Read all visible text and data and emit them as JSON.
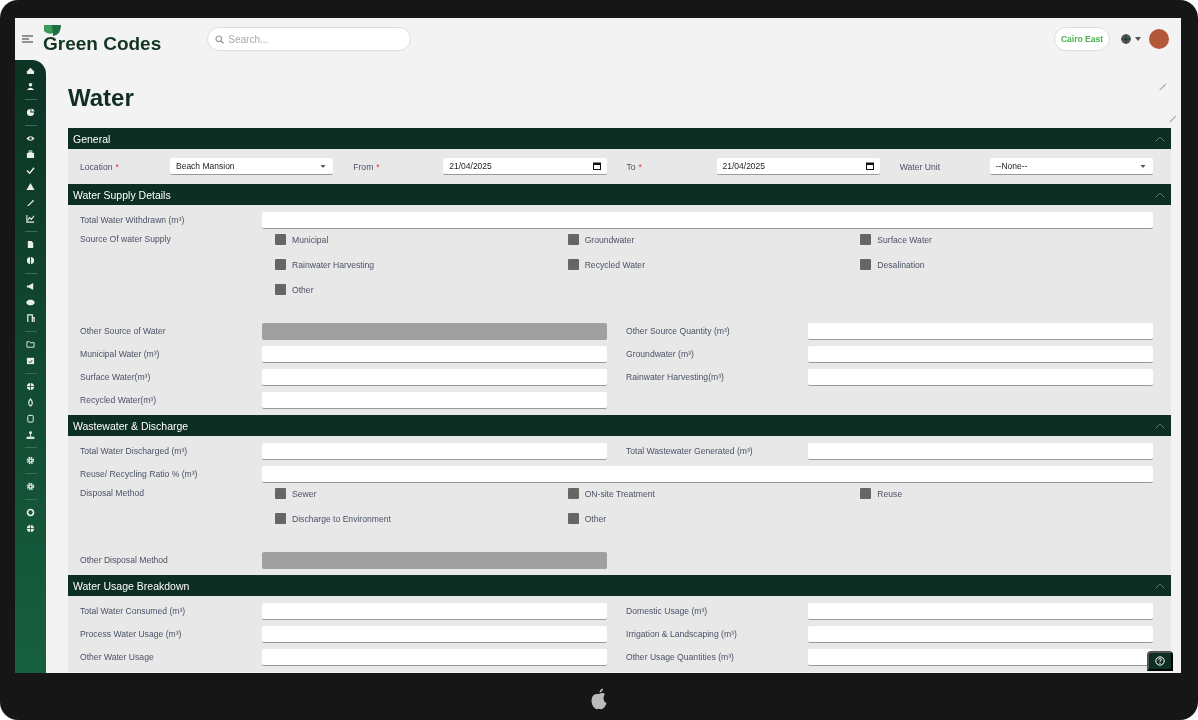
{
  "header": {
    "brand": "Green Codes",
    "search": {
      "placeholder": "Search..."
    },
    "location_chip": "Cairo East"
  },
  "page_title": "Water",
  "sections": [
    {
      "title": "General",
      "expanded": true,
      "rows": [
        {
          "kind": "inline",
          "items": [
            {
              "label": "Location",
              "required_mark": "*",
              "kind": "select",
              "value": "Beach Mansion"
            },
            {
              "label": "From",
              "required_mark": "*",
              "kind": "date",
              "value": "21/04/2025"
            },
            {
              "label": "To",
              "required_mark": "*",
              "kind": "date",
              "value": "21/04/2025"
            },
            {
              "label": "Water Unit",
              "kind": "select",
              "value": "--None--"
            }
          ]
        }
      ]
    },
    {
      "title": "Water Supply Details",
      "expanded": true,
      "rows": [
        {
          "kind": "full",
          "label": "Total Water Withdrawn (m³)"
        },
        {
          "kind": "checks",
          "label": "Source Of water Supply",
          "options": [
            {
              "label": "Municipal",
              "checked": false
            },
            {
              "label": "Groundwater",
              "checked": false
            },
            {
              "label": "Surface Water",
              "checked": false
            },
            {
              "label": "Rainwater Harvesting",
              "checked": false
            },
            {
              "label": "Recycled Water",
              "checked": false
            },
            {
              "label": "Desalination",
              "checked": false
            },
            {
              "label": "Other",
              "checked": false
            }
          ]
        },
        {
          "kind": "pair",
          "fields": [
            {
              "label": "Other Source of Water",
              "disabled": true
            },
            {
              "label": "Other Source Quantity (m³)",
              "disabled": false
            }
          ]
        },
        {
          "kind": "pair",
          "fields": [
            {
              "label": "Municipal Water (m³)",
              "disabled": false
            },
            {
              "label": "Groundwater (m³)",
              "disabled": false
            }
          ]
        },
        {
          "kind": "pair",
          "fields": [
            {
              "label": "Surface Water(m³)",
              "disabled": false
            },
            {
              "label": "Rainwater Harvesting(m³)",
              "disabled": false
            }
          ]
        },
        {
          "kind": "pair",
          "fields": [
            {
              "label": "Recycled Water(m³)",
              "disabled": false
            }
          ]
        }
      ]
    },
    {
      "title": "Wastewater & Discharge",
      "expanded": true,
      "rows": [
        {
          "kind": "pair",
          "fields": [
            {
              "label": "Total Water Discharged (m³)",
              "disabled": false
            },
            {
              "label": "Total Wastewater Generated (m³)",
              "disabled": false
            }
          ]
        },
        {
          "kind": "full",
          "label": "Reuse/ Recycling Ratio % (m³)"
        },
        {
          "kind": "checks",
          "label": "Disposal Method",
          "options": [
            {
              "label": "Sewer",
              "checked": false
            },
            {
              "label": "ON-site Treatment",
              "checked": false
            },
            {
              "label": "Reuse",
              "checked": false
            },
            {
              "label": "Discharge to Environment",
              "checked": false
            },
            {
              "label": "Other",
              "checked": false
            }
          ]
        },
        {
          "kind": "pair",
          "fields": [
            {
              "label": "Other Disposal Method",
              "disabled": true
            }
          ]
        }
      ]
    },
    {
      "title": "Water Usage Breakdown",
      "expanded": true,
      "rows": [
        {
          "kind": "pair",
          "fields": [
            {
              "label": "Total Water Consumed (m³)",
              "disabled": false
            },
            {
              "label": "Domestic Usage (m³)",
              "disabled": false
            }
          ]
        },
        {
          "kind": "pair",
          "fields": [
            {
              "label": "Process Water Usage (m³)",
              "disabled": false
            },
            {
              "label": "Irrigation & Landscaping (m³)",
              "disabled": false
            }
          ]
        },
        {
          "kind": "pair",
          "fields": [
            {
              "label": "Other Water Usage",
              "disabled": false
            },
            {
              "label": "Other Usage Quantities (m³)",
              "disabled": false
            }
          ]
        }
      ]
    }
  ]
}
